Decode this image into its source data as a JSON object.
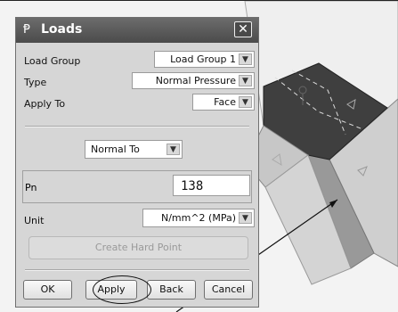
{
  "dialog": {
    "title": "Loads",
    "app_icon": "Ᵽ",
    "close_icon": "✕",
    "load_group": {
      "label": "Load Group",
      "value": "Load Group 1"
    },
    "type": {
      "label": "Type",
      "value": "Normal Pressure"
    },
    "apply_to": {
      "label": "Apply To",
      "value": "Face"
    },
    "direction": {
      "value": "Normal To"
    },
    "pn": {
      "label": "Pn",
      "value": "138"
    },
    "unit": {
      "label": "Unit",
      "value": "N/mm^2 (MPa)"
    },
    "create_hard_point": "Create Hard Point",
    "buttons": {
      "ok": "OK",
      "apply": "Apply",
      "back": "Back",
      "cancel": "Cancel"
    }
  },
  "icons": {
    "dropdown": "chevron-down-icon",
    "close": "close-icon",
    "app": "loads-icon"
  }
}
